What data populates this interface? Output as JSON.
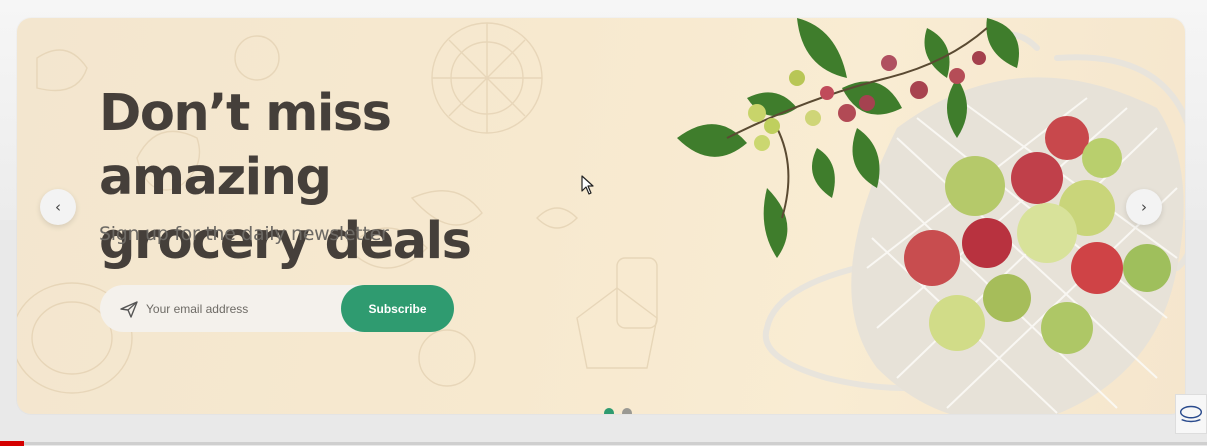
{
  "hero": {
    "headline_line1": "Don’t miss amazing",
    "headline_line2": "grocery deals",
    "subheadline": "Sign up for the daily newsletter"
  },
  "newsletter": {
    "email_placeholder": "Your email address",
    "email_value": "",
    "subscribe_label": "Subscribe",
    "send_icon": "paper-plane-icon"
  },
  "carousel": {
    "prev_icon": "chevron-left-icon",
    "next_icon": "chevron-right-icon",
    "prev_glyph": "‹",
    "next_glyph": "›",
    "slide_count": 2,
    "active_slide": 1
  },
  "colors": {
    "accent": "#2f9b70",
    "headline": "#453f3a",
    "banner_background": "#f6e8cf",
    "inactive_dot": "#9a9993",
    "video_progress": "#d50000"
  }
}
